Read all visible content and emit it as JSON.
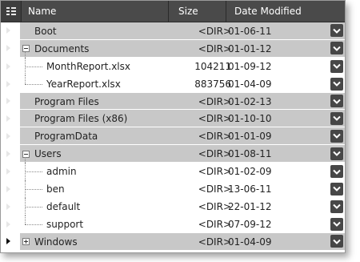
{
  "columns": {
    "name": "Name",
    "size": "Size",
    "date": "Date Modified"
  },
  "rows": [
    {
      "name": "Boot",
      "size": "<DIR>",
      "date": "01-06-11",
      "level": 0,
      "toggle": "none",
      "shade": "gray",
      "current": false,
      "last_child": false
    },
    {
      "name": "Documents",
      "size": "<DIR>",
      "date": "01-01-12",
      "level": 0,
      "toggle": "minus",
      "shade": "gray",
      "current": false,
      "last_child": false
    },
    {
      "name": "MonthReport.xlsx",
      "size": "104211",
      "date": "01-09-12",
      "level": 1,
      "toggle": "none",
      "shade": "white",
      "current": false,
      "last_child": false
    },
    {
      "name": "YearReport.xlsx",
      "size": "883756",
      "date": "01-04-09",
      "level": 1,
      "toggle": "none",
      "shade": "white",
      "current": false,
      "last_child": true
    },
    {
      "name": "Program Files",
      "size": "<DIR>",
      "date": "01-02-13",
      "level": 0,
      "toggle": "none",
      "shade": "gray",
      "current": false,
      "last_child": false
    },
    {
      "name": "Program Files (x86)",
      "size": "<DIR>",
      "date": "01-10-10",
      "level": 0,
      "toggle": "none",
      "shade": "gray",
      "current": false,
      "last_child": false
    },
    {
      "name": "ProgramData",
      "size": "<DIR>",
      "date": "01-01-09",
      "level": 0,
      "toggle": "none",
      "shade": "gray",
      "current": false,
      "last_child": false
    },
    {
      "name": "Users",
      "size": "<DIR>",
      "date": "01-08-11",
      "level": 0,
      "toggle": "minus",
      "shade": "gray",
      "current": false,
      "last_child": false
    },
    {
      "name": "admin",
      "size": "<DIR>",
      "date": "01-02-09",
      "level": 1,
      "toggle": "none",
      "shade": "white",
      "current": false,
      "last_child": false
    },
    {
      "name": "ben",
      "size": "<DIR>",
      "date": "13-06-11",
      "level": 1,
      "toggle": "none",
      "shade": "white",
      "current": false,
      "last_child": false
    },
    {
      "name": "default",
      "size": "<DIR>",
      "date": "22-01-12",
      "level": 1,
      "toggle": "none",
      "shade": "white",
      "current": false,
      "last_child": false
    },
    {
      "name": "support",
      "size": "<DIR>",
      "date": "07-09-12",
      "level": 1,
      "toggle": "none",
      "shade": "white",
      "current": false,
      "last_child": true
    },
    {
      "name": "Windows",
      "size": "<DIR>",
      "date": "01-04-09",
      "level": 0,
      "toggle": "plus",
      "shade": "gray",
      "current": true,
      "last_child": false
    }
  ],
  "icons": {
    "column_chooser": "column-chooser-icon",
    "dropdown": "chevron-down-icon",
    "row_indicator": "row-indicator-arrow-icon"
  },
  "colors": {
    "header_bg": "#4a4a4a",
    "row_gray": "#c8c8c8",
    "dropdown_bg": "#474747"
  }
}
